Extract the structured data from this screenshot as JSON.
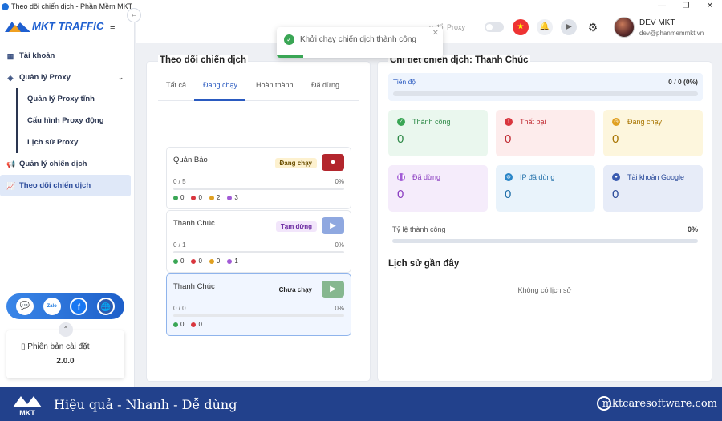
{
  "window": {
    "title": "Theo dõi chiến dịch - Phần Mềm MKT",
    "controls": [
      "—",
      "❐",
      "✕"
    ]
  },
  "brand": {
    "name": "MKT TRAFFIC"
  },
  "sidebar": {
    "items": [
      {
        "label": "Tài khoản",
        "icon": "grid-icon"
      },
      {
        "label": "Quản lý Proxy",
        "icon": "layers-icon"
      },
      {
        "label": "Quản lý Proxy tĩnh"
      },
      {
        "label": "Cấu hình Proxy động"
      },
      {
        "label": "Lịch sử Proxy"
      },
      {
        "label": "Quản lý chiến dịch",
        "icon": "megaphone-icon"
      },
      {
        "label": "Theo dõi chiến dịch",
        "icon": "chart-icon"
      }
    ],
    "version_label": "Phiên bản cài đặt",
    "version": "2.0.0",
    "social": {
      "zalo": "Zalo",
      "facebook": "f"
    }
  },
  "topbar": {
    "proxy_label": "g đổi Proxy",
    "user_name": "DEV MKT",
    "user_email": "dev@phanmemmkt.vn"
  },
  "toast": {
    "message": "Khởi chạy chiến dịch thành công"
  },
  "left_panel": {
    "title": "Theo dõi chiến dịch",
    "tabs": [
      "Tất cả",
      "Đang chạy",
      "Hoàn thành",
      "Đã dừng"
    ],
    "campaigns": [
      {
        "name": "Quản Bảo",
        "status": "Đang chạy",
        "progress": "0 / 5",
        "percent": "0%",
        "stats": [
          "0",
          "0",
          "2",
          "3"
        ]
      },
      {
        "name": "Thanh Chúc",
        "status": "Tạm dừng",
        "progress": "0 / 1",
        "percent": "0%",
        "stats": [
          "0",
          "0",
          "0",
          "1"
        ]
      },
      {
        "name": "Thanh Chúc",
        "status": "Chưa chạy",
        "progress": "0 / 0",
        "percent": "0%",
        "stats": [
          "0",
          "0"
        ]
      }
    ]
  },
  "right_panel": {
    "title": "Chi tiết chiến dịch: Thanh Chúc",
    "progress_label": "Tiến độ",
    "progress_value": "0 / 0 (0%)",
    "cards": [
      {
        "label": "Thành công",
        "value": "0"
      },
      {
        "label": "Thất bại",
        "value": "0"
      },
      {
        "label": "Đang chạy",
        "value": "0"
      },
      {
        "label": "Đã dừng",
        "value": "0"
      },
      {
        "label": "IP đã dùng",
        "value": "0"
      },
      {
        "label": "Tài khoản Google",
        "value": "0"
      }
    ],
    "rate_label": "Tỷ lệ thành công",
    "rate_value": "0%",
    "history_title": "Lịch sử gần đây",
    "history_empty": "Không có lịch sử"
  },
  "footer": {
    "slogan": "Hiệu quả - Nhanh - Dễ dùng",
    "site": "mktcaresoftware.com",
    "logo_text": "MKT"
  },
  "colors": {
    "primary": "#2a5ac0",
    "success": "#3aa655",
    "danger": "#d9363e",
    "warning": "#e0a020",
    "purple": "#a25bd6",
    "footer": "#22418c"
  }
}
